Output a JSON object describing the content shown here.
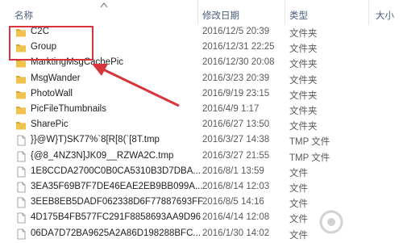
{
  "columns": {
    "name": "名称",
    "date": "修改日期",
    "type": "类型",
    "size": "大小"
  },
  "files": [
    {
      "name": "C2C",
      "date": "2016/12/5 20:39",
      "type": "文件夹",
      "kind": "folder"
    },
    {
      "name": "Group",
      "date": "2016/12/31 22:25",
      "type": "文件夹",
      "kind": "folder"
    },
    {
      "name": "MarktingMsgCachePic",
      "date": "2016/12/30 20:08",
      "type": "文件夹",
      "kind": "folder"
    },
    {
      "name": "MsgWander",
      "date": "2016/3/23 20:39",
      "type": "文件夹",
      "kind": "folder"
    },
    {
      "name": "PhotoWall",
      "date": "2016/9/19 23:15",
      "type": "文件夹",
      "kind": "folder"
    },
    {
      "name": "PicFileThumbnails",
      "date": "2016/4/9 1:17",
      "type": "文件夹",
      "kind": "folder"
    },
    {
      "name": "SharePic",
      "date": "2016/6/27 13:50",
      "type": "文件夹",
      "kind": "folder"
    },
    {
      "name": "}}@W}T)SK77%`8[R[8(`[8T.tmp",
      "date": "2016/3/27 14:38",
      "type": "TMP 文件",
      "kind": "file"
    },
    {
      "name": "{@8_4NZ3N]JK09__RZWA2C.tmp",
      "date": "2016/3/27 21:55",
      "type": "TMP 文件",
      "kind": "file"
    },
    {
      "name": "1E8CCDA2700C0B0CA5310B3D7DBA...",
      "date": "2016/8/1 13:59",
      "type": "文件",
      "kind": "file"
    },
    {
      "name": "3EA35F69B7F7DE46EAE2EB9BB099A...",
      "date": "2016/8/14 12:03",
      "type": "文件",
      "kind": "file"
    },
    {
      "name": "3EEB8EB5DADF062338D6F77887693FF",
      "date": "2016/8/5 14:16",
      "type": "文件",
      "kind": "file"
    },
    {
      "name": "4D175B4FB577FC291F8858693AA9D96",
      "date": "2016/4/14 12:08",
      "type": "文件",
      "kind": "file"
    },
    {
      "name": "06DA7D72BA9625A2A86D198288BFC...",
      "date": "2016/1/30 14:02",
      "type": "文件",
      "kind": "file"
    }
  ],
  "colors": {
    "folder": "#f0c34e",
    "folder_dark": "#d9a62c",
    "highlight": "#d6363b",
    "header_text": "#4c607a"
  },
  "icons": {
    "folder": "folder-icon",
    "file": "file-icon",
    "sort": "chevron-up-icon",
    "annotation": "arrow-annotation"
  }
}
